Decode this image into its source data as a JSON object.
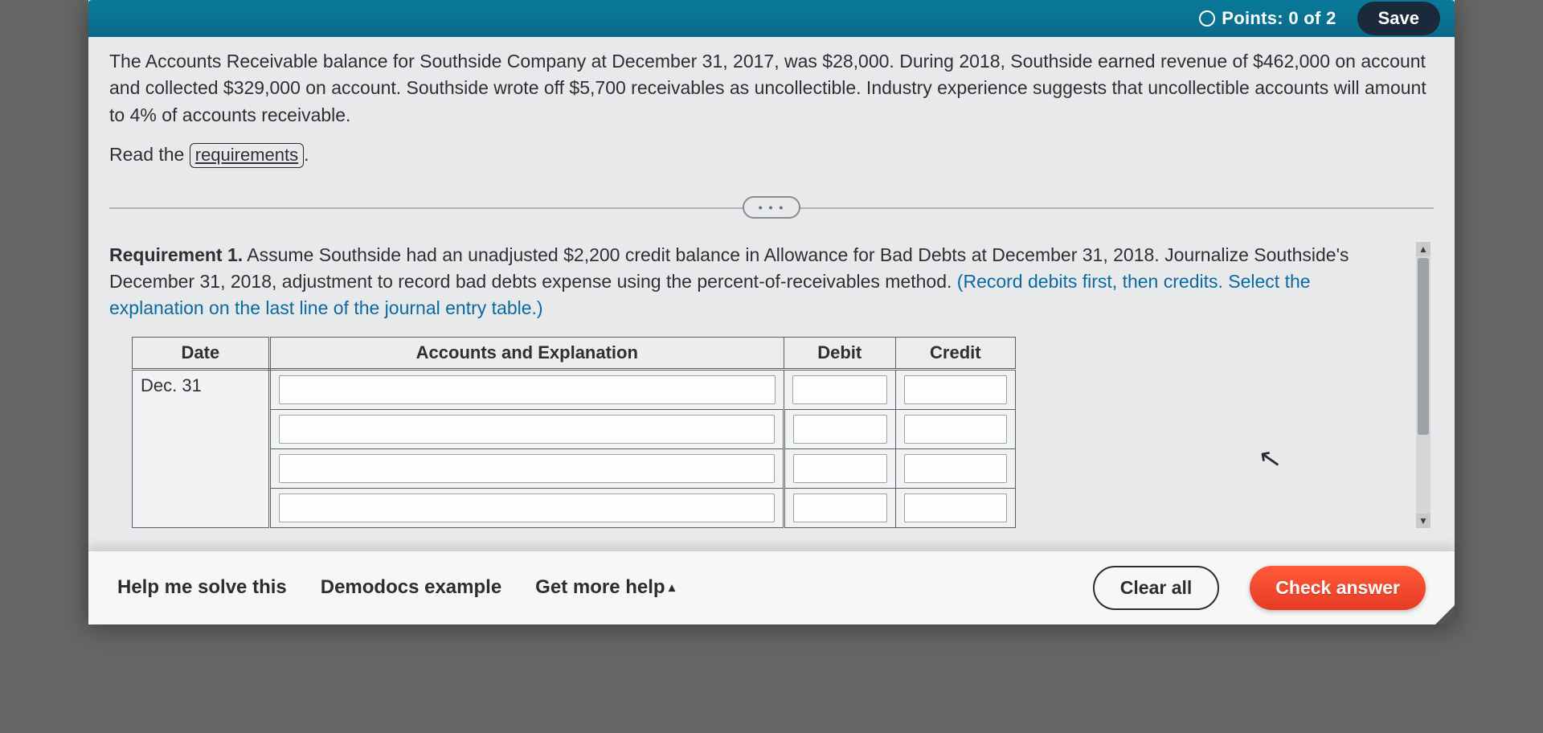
{
  "topbar": {
    "points_label": "Points: 0 of 2",
    "save_label": "Save"
  },
  "problem": {
    "text": "The Accounts Receivable balance for Southside Company at December 31, 2017, was $28,000. During 2018, Southside earned revenue of $462,000 on account and collected $329,000 on account. Southside wrote off $5,700 receivables as uncollectible. Industry experience suggests that uncollectible accounts will amount to 4% of accounts receivable.",
    "read_prefix": "Read the ",
    "read_link": "requirements",
    "read_suffix": "."
  },
  "expander": {
    "dots": "• • •"
  },
  "requirement": {
    "heading": "Requirement 1.",
    "body": " Assume Southside had an unadjusted $2,200 credit balance in Allowance for Bad Debts at December 31, 2018. Journalize Southside's December 31, 2018, adjustment to record bad debts expense using the percent-of-receivables method. ",
    "hint": "(Record debits first, then credits. Select the explanation on the last line of the journal entry table.)"
  },
  "journal": {
    "headers": {
      "date": "Date",
      "acct": "Accounts and Explanation",
      "debit": "Debit",
      "credit": "Credit"
    },
    "date_value": "Dec. 31",
    "rows": 4
  },
  "footer": {
    "help_solve": "Help me solve this",
    "demodocs": "Demodocs example",
    "more_help": "Get more help",
    "clear_all": "Clear all",
    "check_answer": "Check answer"
  }
}
